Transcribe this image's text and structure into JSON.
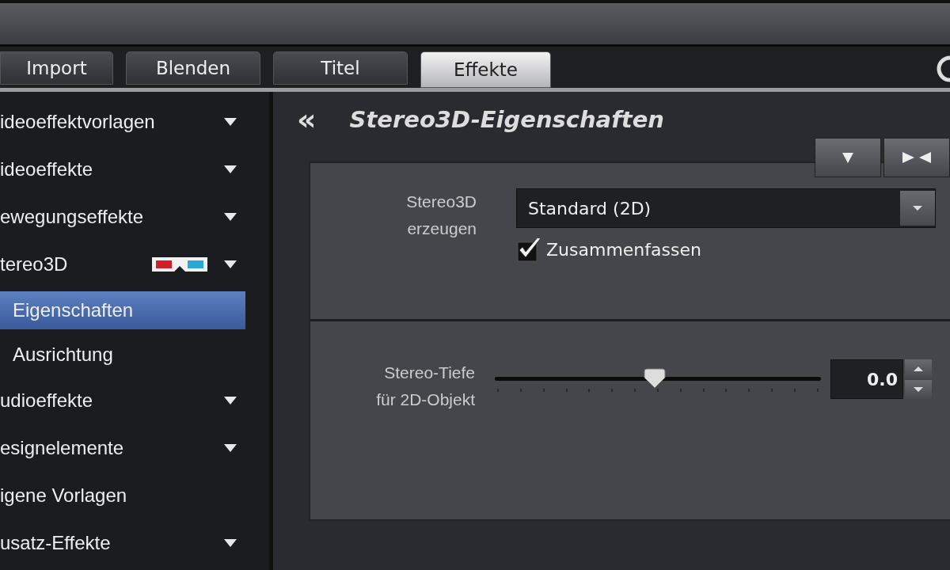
{
  "tabs": [
    {
      "label": "Import",
      "selected": false
    },
    {
      "label": "Blenden",
      "selected": false
    },
    {
      "label": "Titel",
      "selected": false
    },
    {
      "label": "Effekte",
      "selected": true
    }
  ],
  "sidebar": {
    "items": [
      {
        "label": "ideoeffektvorlagen",
        "caret": true,
        "selected": false
      },
      {
        "label": "ideoeffekte",
        "caret": true,
        "selected": false
      },
      {
        "label": "ewegungseffekte",
        "caret": true,
        "selected": false
      },
      {
        "label": "tereo3D",
        "caret": true,
        "selected": false,
        "kind": "stereo",
        "children": [
          {
            "label": "Eigenschaften",
            "caret": false,
            "selected": true
          },
          {
            "label": "Ausrichtung",
            "caret": false,
            "selected": false
          }
        ]
      },
      {
        "label": "udioeffekte",
        "caret": true,
        "selected": false
      },
      {
        "label": "esignelemente",
        "caret": true,
        "selected": false
      },
      {
        "label": "igene Vorlagen",
        "caret": false,
        "selected": false
      },
      {
        "label": "usatz-Effekte",
        "caret": true,
        "selected": false
      }
    ]
  },
  "panel": {
    "back": "«",
    "title": "Stereo3D-Eigenschaften",
    "stereo_section": {
      "label": "Stereo3D erzeugen",
      "dropdown_value": "Standard (2D)",
      "checkbox": {
        "label": "Zusammenfassen",
        "checked": true
      }
    },
    "depth_section": {
      "label": "Stereo-Tiefe für 2D-Objekt",
      "level": 0.49,
      "value": "0.0"
    }
  }
}
